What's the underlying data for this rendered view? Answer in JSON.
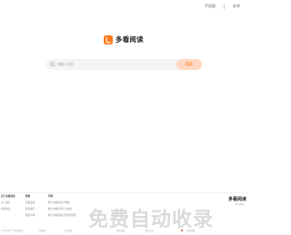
{
  "topnav": {
    "mobile": "手机版",
    "right": "安卓"
  },
  "brand": {
    "name": "多看阅读",
    "logo_color": "#ff7a1a"
  },
  "search": {
    "placeholder": "请输入书名",
    "button": "搜索"
  },
  "footer": {
    "col1": {
      "head": "关于多看阅读",
      "items": [
        "关于我们",
        "阅读协议"
      ]
    },
    "col2": {
      "head": "帮助",
      "items": [
        "隐私政策",
        "联系我们",
        "版权声明"
      ]
    },
    "col3": {
      "head": "声明",
      "items": [
        "网上内容来源于网络",
        "网上内容仅供学习交流",
        "网上内容版权归原作者所有"
      ]
    },
    "bottom": [
      "Copyright © 多看阅读",
      "ICP备案",
      "公安备案",
      "网站地图",
      "联系方式",
      "申诉邮箱"
    ]
  },
  "brand_right": {
    "name": "多看阅读",
    "sub": "duokan"
  },
  "watermark": "免费自动收录"
}
